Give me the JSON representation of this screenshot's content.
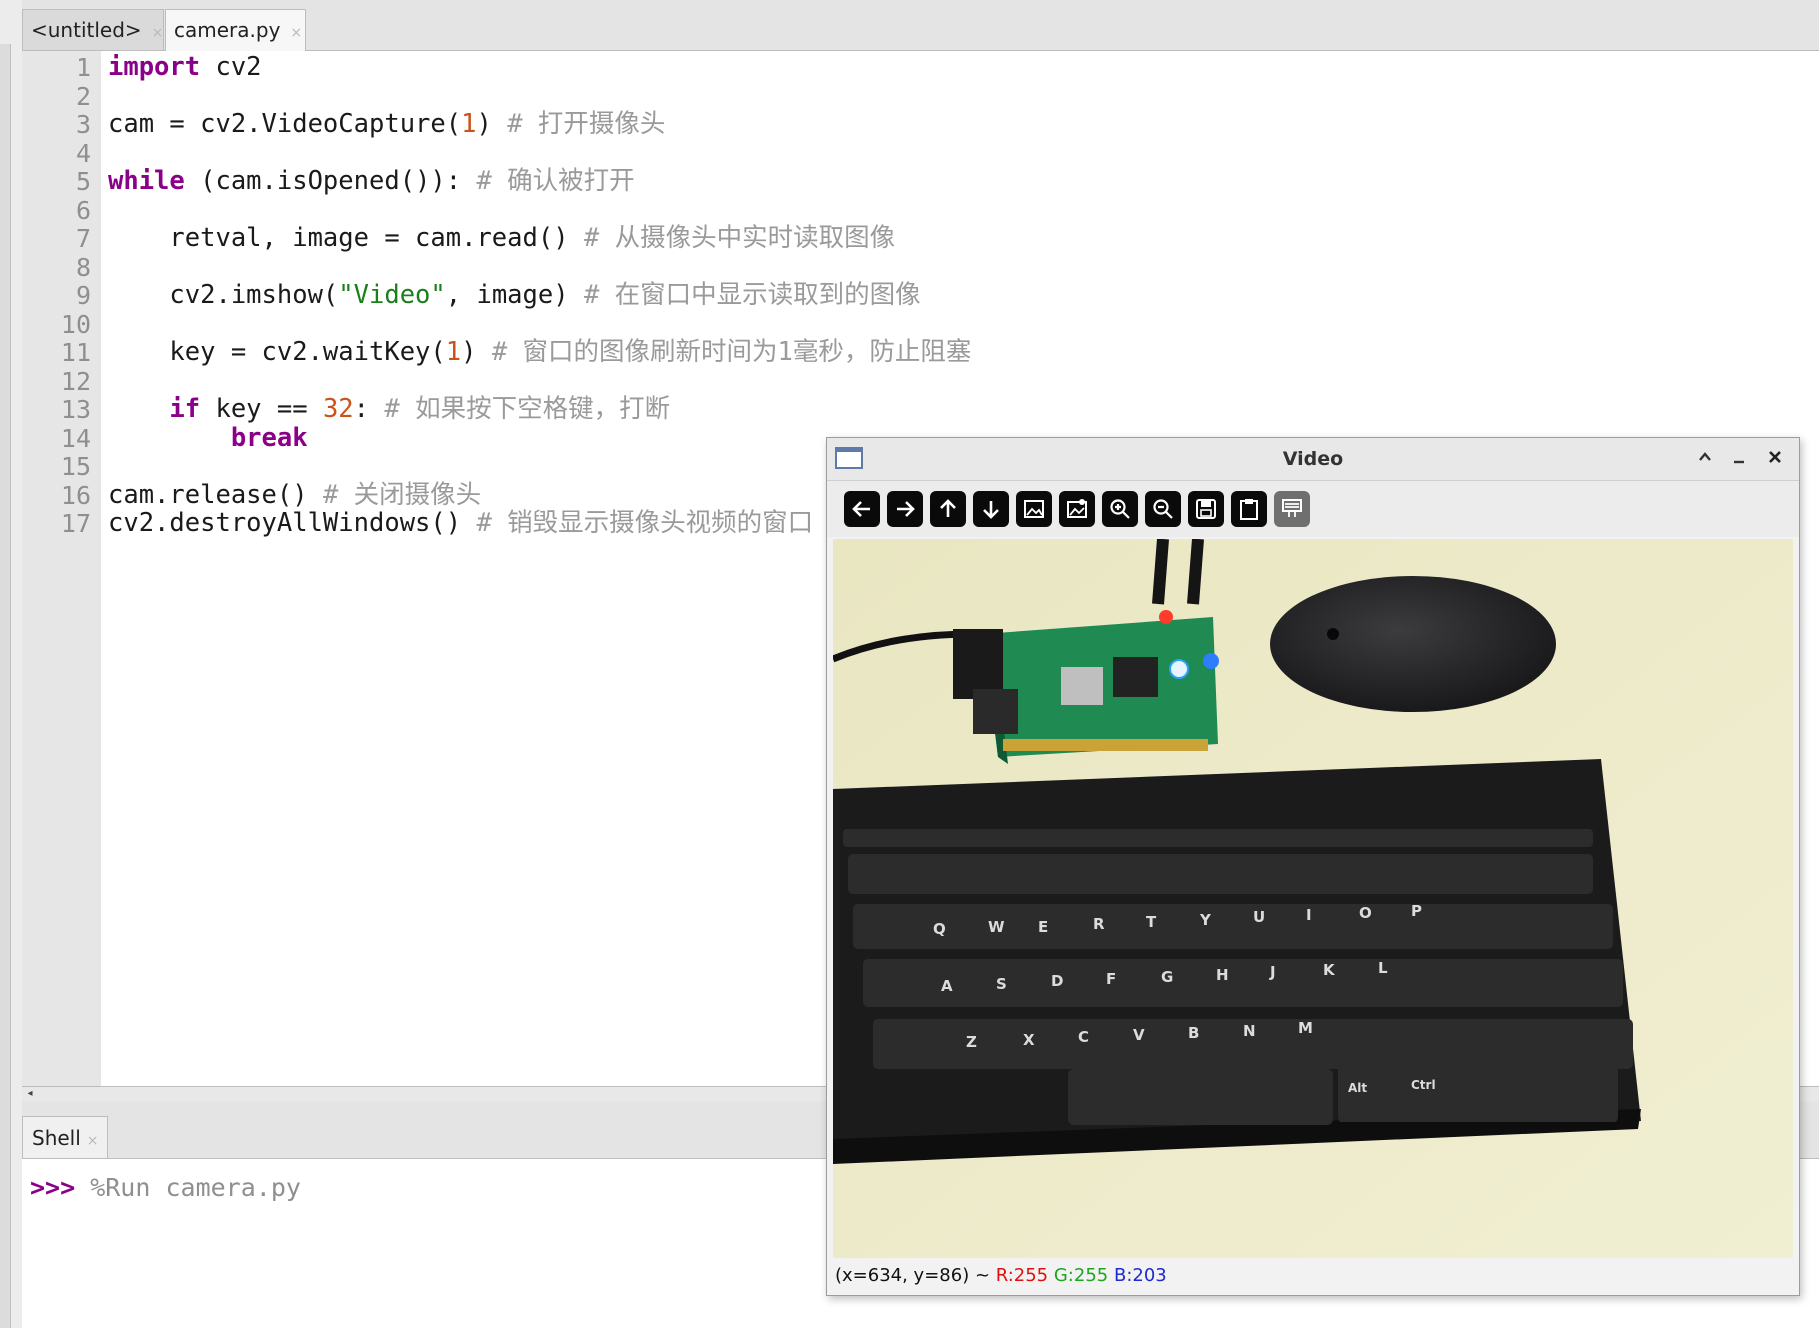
{
  "editor": {
    "tabs": [
      {
        "label": "<untitled>"
      },
      {
        "label": "camera.py"
      }
    ],
    "tab_close_glyph": "×",
    "line_numbers": [
      "1",
      "2",
      "3",
      "4",
      "5",
      "6",
      "7",
      "8",
      "9",
      "10",
      "11",
      "12",
      "13",
      "14",
      "15",
      "16",
      "17"
    ],
    "code": {
      "l1_kw": "import",
      "l1_rest": " cv2",
      "l3_a": "cam = cv2.VideoCapture(",
      "l3_num": "1",
      "l3_b": ") ",
      "l3_cmt": "# 打开摄像头",
      "l5_kw": "while",
      "l5_a": " (cam.isOpened()): ",
      "l5_cmt": "# 确认被打开",
      "l7_a": "    retval, image = cam.read() ",
      "l7_cmt": "# 从摄像头中实时读取图像",
      "l9_a": "    cv2.imshow(",
      "l9_str": "\"Video\"",
      "l9_b": ", image) ",
      "l9_cmt": "# 在窗口中显示读取到的图像",
      "l11_a": "    key = cv2.waitKey(",
      "l11_num": "1",
      "l11_b": ") ",
      "l11_cmt": "# 窗口的图像刷新时间为1毫秒，防止阻塞",
      "l13_kw": "    if",
      "l13_a": " key == ",
      "l13_num": "32",
      "l13_b": ": ",
      "l13_cmt": "# 如果按下空格键，打断",
      "l14_kw": "        break",
      "l16_a": "cam.release() ",
      "l16_cmt": "# 关闭摄像头",
      "l17_a": "cv2.destroyAllWindows() ",
      "l17_cmt": "# 销毁显示摄像头视频的窗口"
    }
  },
  "shell": {
    "tab_label": "Shell",
    "prompt": ">>>",
    "command": " %Run camera.py"
  },
  "video_window": {
    "title": "Video",
    "toolbar_icons": [
      "arrow-left-icon",
      "arrow-right-icon",
      "arrow-up-icon",
      "arrow-down-icon",
      "image-icon",
      "image-settings-icon",
      "zoom-in-icon",
      "zoom-out-icon",
      "save-icon",
      "clipboard-icon",
      "properties-icon"
    ],
    "status": {
      "coords": "(x=634, y=86) ~ ",
      "r": "R:255",
      "g": "G:255",
      "b": "B:203"
    }
  }
}
